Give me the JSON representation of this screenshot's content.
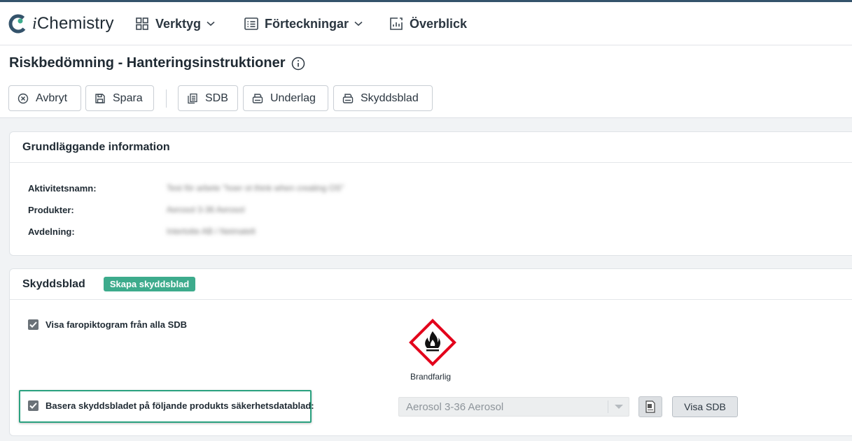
{
  "app": {
    "logo_text_i": "i",
    "logo_text_rest": "Chemistry"
  },
  "nav": {
    "verktyg": "Verktyg",
    "forteckningar": "Förteckningar",
    "overblick": "Överblick"
  },
  "page": {
    "title": "Riskbedömning - Hanteringsinstruktioner"
  },
  "toolbar": {
    "avbryt": "Avbryt",
    "spara": "Spara",
    "sdb": "SDB",
    "underlag": "Underlag",
    "skyddsblad": "Skyddsblad"
  },
  "basic_info": {
    "heading": "Grundläggande information",
    "rows": [
      {
        "label": "Aktivitetsnamn:",
        "value": "Test för arbete \"hoer ot think when creating OS\""
      },
      {
        "label": "Produkter:",
        "value": "Aerosol 3-36 Aerosol"
      },
      {
        "label": "Avdelning:",
        "value": "Intertotte AB / Neimatelt"
      }
    ]
  },
  "skyddsblad": {
    "heading": "Skyddsblad",
    "badge": "Skapa skyddsblad",
    "show_pictograms_label": "Visa faropiktogram från alla SDB",
    "show_pictograms_checked": true,
    "pictogram_label": "Brandfarlig",
    "base_on_sds_label": "Basera skyddsbladet på följande produkts säkerhetsdatablad:",
    "base_on_sds_checked": true,
    "product_select_value": "Aerosol 3-36 Aerosol",
    "visa_sdb": "Visa SDB"
  },
  "colors": {
    "accent": "#3dab8c",
    "topbar": "#34536b",
    "hazard_red": "#e3001b"
  }
}
